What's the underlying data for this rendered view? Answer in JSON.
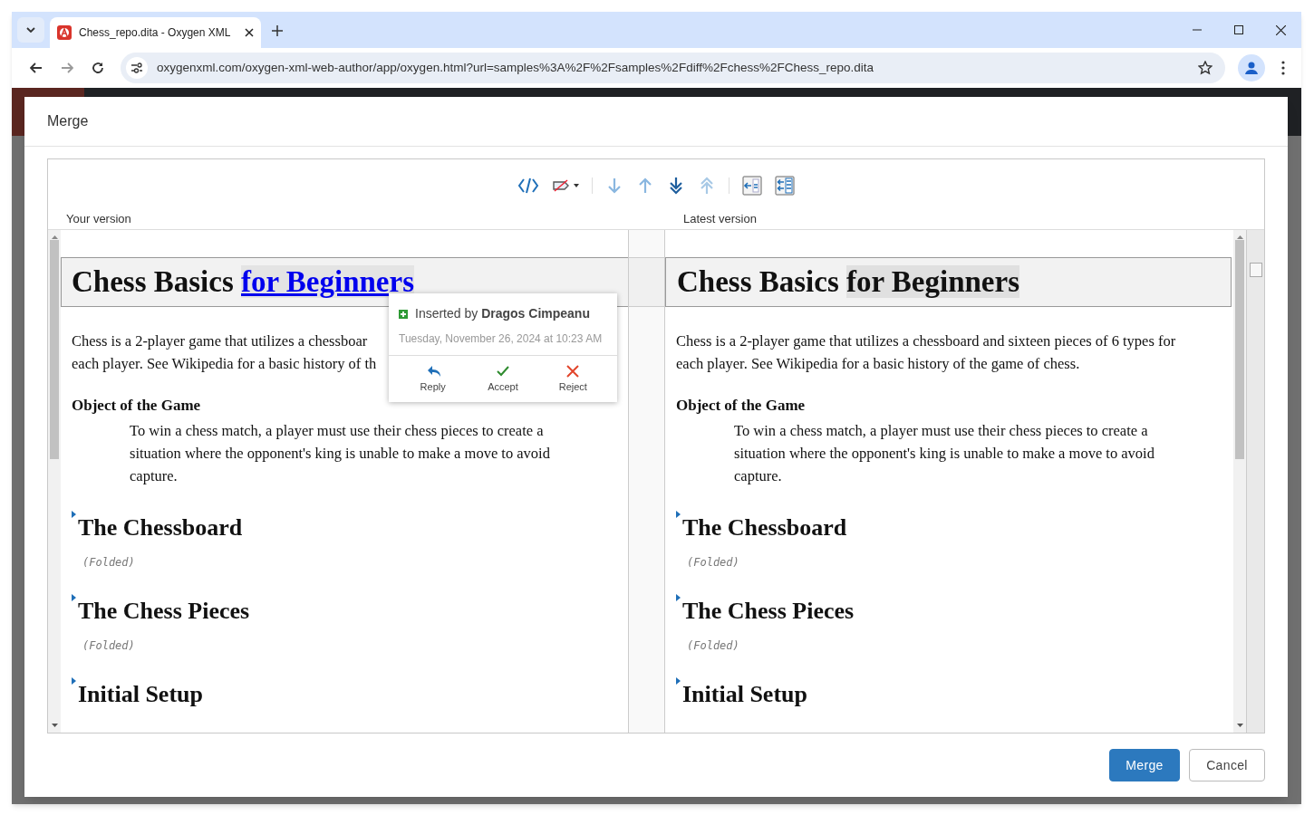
{
  "browser": {
    "tab_title": "Chess_repo.dita - Oxygen XML",
    "url": "oxygenxml.com/oxygen-xml-web-author/app/oxygen.html?url=samples%3A%2F%2Fsamples%2Fdiff%2Fchess%2FChess_repo.dita"
  },
  "dialog": {
    "title": "Merge",
    "panes": [
      {
        "label": "Your version",
        "title_parts": [
          {
            "text": "Chess Basics ",
            "kind": "plain"
          },
          {
            "text": "for Beginners",
            "kind": "inserted"
          }
        ],
        "paragraph_lines": [
          "Chess is a 2-player game that utilizes a chessboar",
          "each player. See Wikipedia for a basic history of th"
        ],
        "section_heading": "Object of the Game",
        "section_text": "To win a chess match, a player must use their chess pieces to create a situation where the opponent's king is unable to make a move to avoid capture.",
        "folded_sections": [
          {
            "title": "The Chessboard",
            "note": "(Folded)"
          },
          {
            "title": "The Chess Pieces",
            "note": "(Folded)"
          },
          {
            "title": "Initial Setup"
          }
        ]
      },
      {
        "label": "Latest version",
        "title_parts": [
          {
            "text": "Chess Basics ",
            "kind": "plain"
          },
          {
            "text": "for Beginners",
            "kind": "changed"
          }
        ],
        "paragraph_lines": [
          "Chess is a 2-player game that utilizes a chessboard and sixteen pieces of 6 types for",
          "each player. See Wikipedia for a basic history of the game of chess."
        ],
        "section_heading": "Object of the Game",
        "section_text": "To win a chess match, a player must use their chess pieces to create a situation where the opponent's king is unable to make a move to avoid capture.",
        "folded_sections": [
          {
            "title": "The Chessboard",
            "note": "(Folded)"
          },
          {
            "title": "The Chess Pieces",
            "note": "(Folded)"
          },
          {
            "title": "Initial Setup"
          }
        ]
      }
    ],
    "change_popup": {
      "heading": "Inserted by **Dragos Cimpeanu**",
      "date": "Tuesday, November 26, 2024 at 10:23 AM",
      "actions": [
        {
          "label": "Reply",
          "kind": "reply"
        },
        {
          "label": "Accept",
          "kind": "accept"
        },
        {
          "label": "Reject",
          "kind": "reject"
        }
      ]
    },
    "buttons": [
      {
        "label": "Merge",
        "kind": "primary"
      },
      {
        "label": "Cancel",
        "kind": "secondary"
      }
    ]
  }
}
